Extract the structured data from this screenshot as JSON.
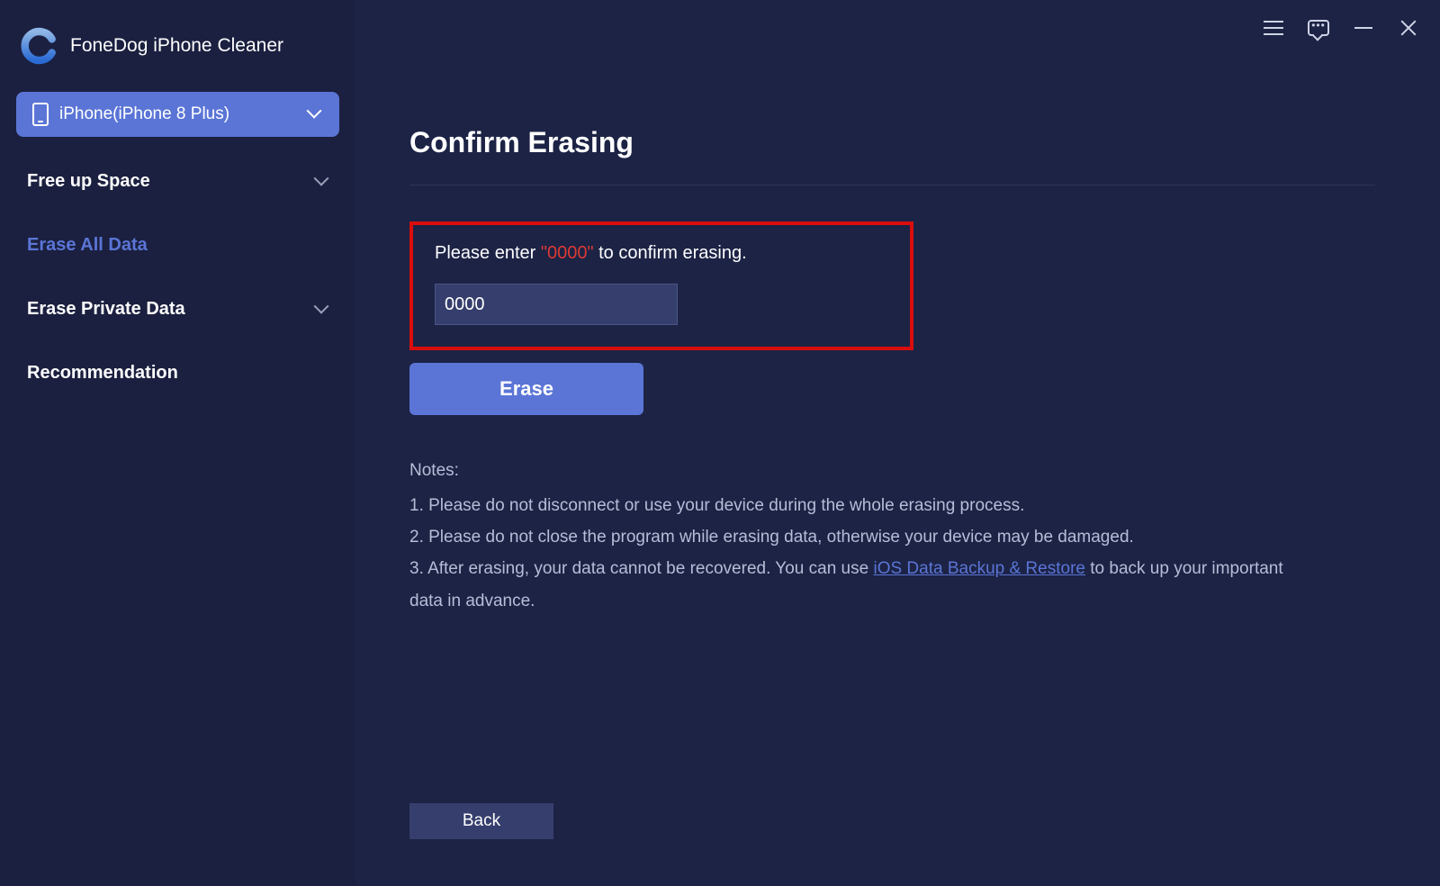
{
  "app": {
    "title": "FoneDog iPhone Cleaner"
  },
  "device_selector": {
    "label": "iPhone(iPhone 8 Plus)"
  },
  "sidebar": {
    "items": [
      {
        "label": "Free up Space",
        "expandable": true,
        "active": false
      },
      {
        "label": "Erase All Data",
        "expandable": false,
        "active": true
      },
      {
        "label": "Erase Private Data",
        "expandable": true,
        "active": false
      },
      {
        "label": "Recommendation",
        "expandable": false,
        "active": false
      }
    ]
  },
  "main": {
    "page_title": "Confirm Erasing",
    "prompt_prefix": "Please enter ",
    "prompt_code": "\"0000\"",
    "prompt_suffix": " to confirm erasing.",
    "input_value": "0000",
    "erase_button": "Erase",
    "back_button": "Back",
    "notes_heading": "Notes:",
    "note1": "1. Please do not disconnect or use your device during the whole erasing process.",
    "note2": "2. Please do not close the program while erasing data, otherwise your device may be damaged.",
    "note3_prefix": "3. After erasing, your data cannot be recovered. You can use ",
    "note3_link": "iOS Data Backup & Restore",
    "note3_suffix": " to back up your important data in advance."
  }
}
